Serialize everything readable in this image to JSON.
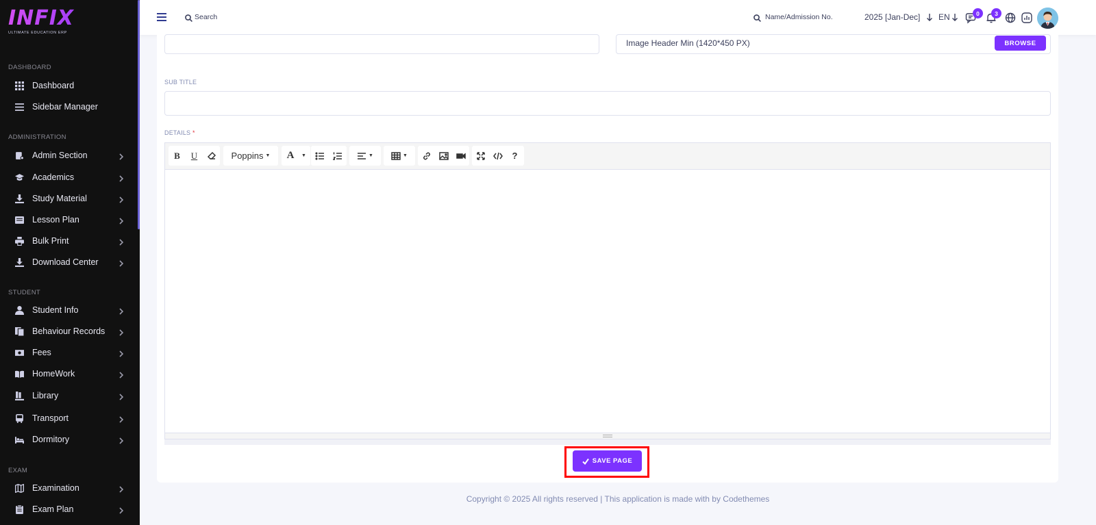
{
  "logo": {
    "text": "INFIX",
    "subtitle": "ULTIMATE EDUCATION ERP"
  },
  "sidebar": {
    "sections": [
      {
        "label": "DASHBOARD",
        "items": [
          {
            "label": "Dashboard",
            "icon": "grid-icon",
            "chevron": false
          },
          {
            "label": "Sidebar Manager",
            "icon": "list-icon",
            "chevron": false
          }
        ]
      },
      {
        "label": "ADMINISTRATION",
        "items": [
          {
            "label": "Admin Section",
            "icon": "admin-icon",
            "chevron": true
          },
          {
            "label": "Academics",
            "icon": "graduation-cap-icon",
            "chevron": true
          },
          {
            "label": "Study Material",
            "icon": "download-icon",
            "chevron": true
          },
          {
            "label": "Lesson Plan",
            "icon": "lesson-icon",
            "chevron": true
          },
          {
            "label": "Bulk Print",
            "icon": "printer-icon",
            "chevron": true
          },
          {
            "label": "Download Center",
            "icon": "download-icon",
            "chevron": true
          }
        ]
      },
      {
        "label": "STUDENT",
        "items": [
          {
            "label": "Student Info",
            "icon": "user-icon",
            "chevron": true
          },
          {
            "label": "Behaviour Records",
            "icon": "records-icon",
            "chevron": true
          },
          {
            "label": "Fees",
            "icon": "money-icon",
            "chevron": true
          },
          {
            "label": "HomeWork",
            "icon": "book-icon",
            "chevron": true
          },
          {
            "label": "Library",
            "icon": "library-icon",
            "chevron": true
          },
          {
            "label": "Transport",
            "icon": "bus-icon",
            "chevron": true
          },
          {
            "label": "Dormitory",
            "icon": "bed-icon",
            "chevron": true
          }
        ]
      },
      {
        "label": "EXAM",
        "items": [
          {
            "label": "Examination",
            "icon": "map-icon",
            "chevron": true
          },
          {
            "label": "Exam Plan",
            "icon": "clipboard-icon",
            "chevron": true
          }
        ]
      }
    ]
  },
  "topbar": {
    "search_placeholder": "Search",
    "admission_placeholder": "Name/Admission No.",
    "year": "2025 [Jan-Dec]",
    "language": "EN",
    "chat_badge": "0",
    "notification_badge": "3"
  },
  "form": {
    "image_header_label": "Image Header Min (1420*450 PX)",
    "browse_label": "BROWSE",
    "sub_title_label": "SUB TITLE",
    "sub_title_value": "",
    "details_label": "DETAILS",
    "details_required": "*",
    "editor_font": "Poppins",
    "save_label": "SAVE PAGE"
  },
  "footer": {
    "text": "Copyright © 2025 All rights reserved | This application is made with by Codethemes"
  },
  "colors": {
    "accent": "#7c32ff",
    "sidebar_bg": "#111111",
    "highlight": "#ff0000"
  }
}
